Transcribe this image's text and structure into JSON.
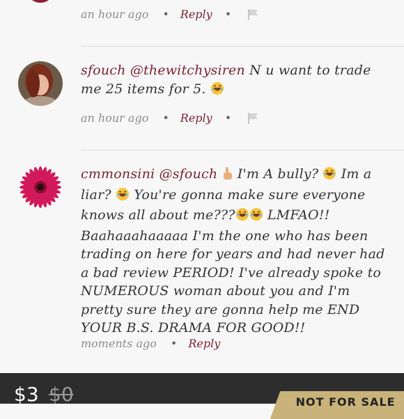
{
  "comments": [
    {
      "time": "an hour ago",
      "reply": "Reply"
    },
    {
      "user": "sfouch",
      "mention": "@thewitchysiren",
      "text_1": " N u want to trade me 25 items for 5. ",
      "time": "an hour ago",
      "reply": "Reply"
    },
    {
      "user": "cmmonsini",
      "mention": "@sfouch",
      "text_1": " I'm A bully? ",
      "text_2": " Im a liar? ",
      "text_3": " You're gonna make sure everyone knows all about me???",
      "text_4": " LMFAO!! Baahaaahaaaaa I'm the one who has been trading on here for years and had never had a bad review PERIOD! I've already spoke to NUMEROUS woman about you and I'm pretty sure they are gonna help me END YOUR B.S. DRAMA FOR GOOD!!",
      "time": "moments ago",
      "reply": "Reply"
    }
  ],
  "listing": {
    "price": "$3",
    "original_price": "$0",
    "badge": "NOT FOR SALE"
  },
  "colors": {
    "username": "#7a2233",
    "bottom_bar": "#2d2d2d",
    "badge": "#c9b37a"
  }
}
